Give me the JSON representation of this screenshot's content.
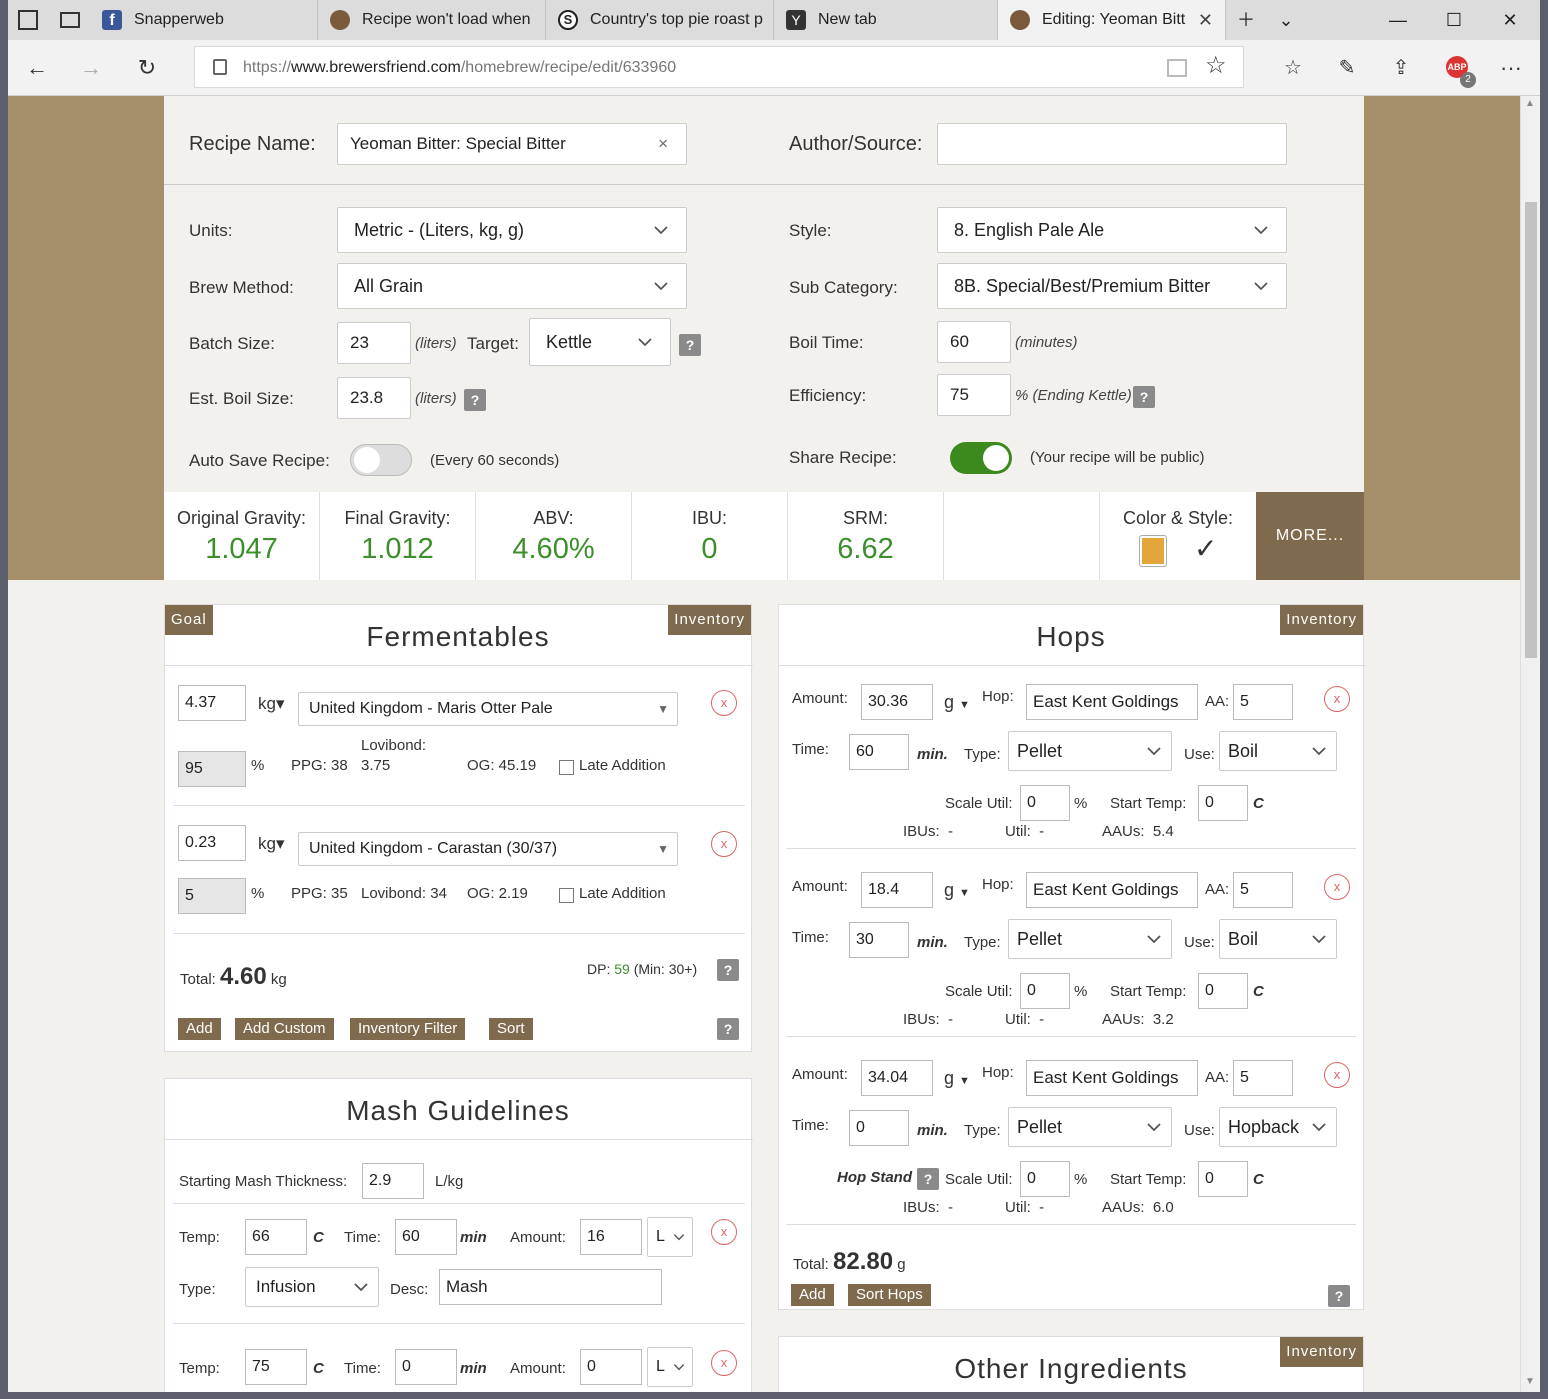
{
  "browser": {
    "tabs": [
      {
        "label": "Snapperweb",
        "icon": "facebook-icon"
      },
      {
        "label": "Recipe won't load when",
        "icon": "brewersfriend-icon"
      },
      {
        "label": "Country's top pie roast p",
        "icon": "snapper-icon"
      },
      {
        "label": "New tab",
        "icon": "new-tab-icon"
      },
      {
        "label": "Editing: Yeoman Bitt",
        "icon": "brewersfriend-icon"
      }
    ],
    "url_prefix": "https://",
    "url_host": "www.brewersfriend.com",
    "url_path": "/homebrew/recipe/edit/633960",
    "adblock_badge": "2"
  },
  "form": {
    "recipe_name_label": "Recipe Name:",
    "recipe_name": "Yeoman Bitter: Special Bitter",
    "clear": "×",
    "author_label": "Author/Source:",
    "author": "",
    "units_label": "Units:",
    "units": "Metric - (Liters, kg, g)",
    "style_label": "Style:",
    "style": "8. English Pale Ale",
    "brew_method_label": "Brew Method:",
    "brew_method": "All Grain",
    "subcat_label": "Sub Category:",
    "subcat": "8B. Special/Best/Premium Bitter",
    "batch_label": "Batch Size:",
    "batch": "23",
    "liters": "(liters)",
    "target_label": "Target:",
    "target": "Kettle",
    "boil_time_label": "Boil Time:",
    "boil_time": "60",
    "minutes": "(minutes)",
    "est_boil_label": "Est. Boil Size:",
    "est_boil": "23.8",
    "efficiency_label": "Efficiency:",
    "efficiency": "75",
    "efficiency_hint": "% (Ending Kettle)",
    "autosave_label": "Auto Save Recipe:",
    "autosave_hint": "(Every 60 seconds)",
    "autosave_on": false,
    "share_label": "Share Recipe:",
    "share_hint": "(Your recipe will be public)",
    "share_on": true,
    "qm": "?"
  },
  "stats": {
    "og_label": "Original Gravity:",
    "og": "1.047",
    "fg_label": "Final Gravity:",
    "fg": "1.012",
    "abv_label": "ABV:",
    "abv": "4.60%",
    "ibu_label": "IBU:",
    "ibu": "0",
    "srm_label": "SRM:",
    "srm": "6.62",
    "color_label": "Color & Style:",
    "check": "✓",
    "more": "MORE..."
  },
  "fermentables": {
    "title": "Fermentables",
    "goal": "Goal",
    "inventory": "Inventory",
    "unit": "kg▾",
    "pct": "%",
    "late": "Late Addition",
    "items": [
      {
        "amount": "4.37",
        "name": "United Kingdom - Maris Otter Pale",
        "percent": "95",
        "ppg": "PPG: 38",
        "lov_label": "Lovibond:",
        "lov": "3.75",
        "og": "OG: 45.19"
      },
      {
        "amount": "0.23",
        "name": "United Kingdom - Carastan (30/37)",
        "percent": "5",
        "ppg": "PPG: 35",
        "lov_label": "Lovibond: 34",
        "lov": "",
        "og": "OG: 2.19"
      }
    ],
    "total_label": "Total:",
    "total": "4.60",
    "total_unit": "kg",
    "dp_label": "DP:",
    "dp": "59",
    "dp_min": "(Min: 30+)",
    "buttons": [
      "Add",
      "Add Custom",
      "Inventory Filter",
      "Sort"
    ]
  },
  "mash": {
    "title": "Mash Guidelines",
    "thickness_label": "Starting Mash Thickness:",
    "thickness": "2.9",
    "thickness_unit": "L/kg",
    "temp_label": "Temp:",
    "c": "C",
    "time_label": "Time:",
    "min": "min",
    "amount_label": "Amount:",
    "type_label": "Type:",
    "desc_label": "Desc:",
    "steps": [
      {
        "temp": "66",
        "time": "60",
        "amount": "16",
        "unit": "L",
        "type": "Infusion",
        "desc": "Mash"
      },
      {
        "temp": "75",
        "time": "0",
        "amount": "0",
        "unit": "L"
      }
    ]
  },
  "hops": {
    "title": "Hops",
    "inventory": "Inventory",
    "amount_label": "Amount:",
    "g": "g",
    "hop_label": "Hop:",
    "aa_label": "AA:",
    "time_label": "Time:",
    "min": "min.",
    "type_label": "Type:",
    "use_label": "Use:",
    "scale_label": "Scale Util:",
    "pct": "%",
    "start_label": "Start Temp:",
    "c": "C",
    "ibus": "IBUs:  -",
    "util": "Util:  -",
    "hopstand": "Hop Stand",
    "items": [
      {
        "amount": "30.36",
        "name": "East Kent Goldings",
        "aa": "5",
        "time": "60",
        "type": "Pellet",
        "use": "Boil",
        "scale": "0",
        "start": "0",
        "aaus": "AAUs:  5.4"
      },
      {
        "amount": "18.4",
        "name": "East Kent Goldings",
        "aa": "5",
        "time": "30",
        "type": "Pellet",
        "use": "Boil",
        "scale": "0",
        "start": "0",
        "aaus": "AAUs:  3.2"
      },
      {
        "amount": "34.04",
        "name": "East Kent Goldings",
        "aa": "5",
        "time": "0",
        "type": "Pellet",
        "use": "Hopback",
        "scale": "0",
        "start": "0",
        "aaus": "AAUs:  6.0"
      }
    ],
    "total_label": "Total:",
    "total": "82.80",
    "total_unit": "g",
    "buttons": [
      "Add",
      "Sort Hops"
    ]
  },
  "other": {
    "title": "Other Ingredients",
    "inventory": "Inventory"
  },
  "colors": {
    "accent": "#806a4e",
    "green": "#3c8f2a",
    "hero": "#a68f6b"
  }
}
